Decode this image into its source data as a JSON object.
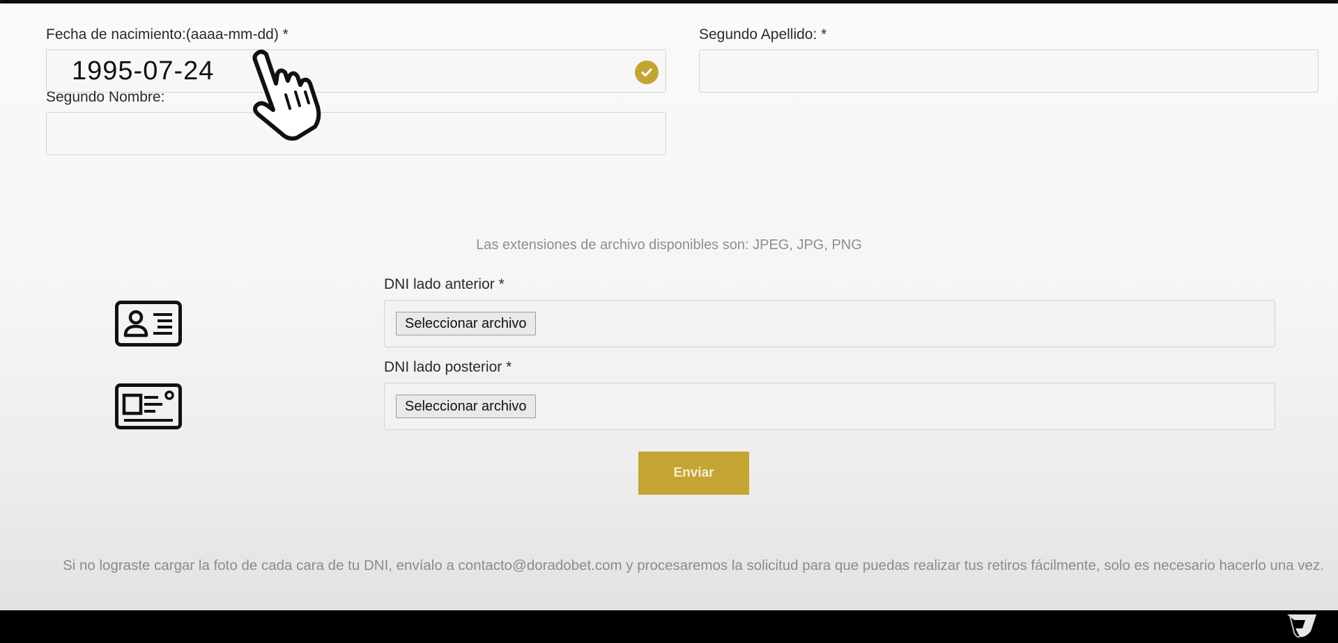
{
  "form": {
    "birthdate_label": "Fecha de nacimiento:(aaaa-mm-dd) *",
    "birthdate_value": "1995-07-24",
    "second_surname_label": "Segundo Apellido: *",
    "second_surname_value": "",
    "second_name_label": "Segundo Nombre:",
    "second_name_value": ""
  },
  "upload": {
    "extensions_note": "Las extensiones de archivo disponibles son: JPEG, JPG, PNG",
    "front_label": "DNI lado anterior *",
    "front_button": "Seleccionar archivo",
    "back_label": "DNI lado posterior *",
    "back_button": "Seleccionar archivo"
  },
  "submit_label": "Enviar",
  "footer_note": "Si no lograste cargar la foto de cada cara de tu DNI, envíalo a contacto@doradobet.com y procesaremos la solicitud para que puedas realizar tus retiros fácilmente, solo es necesario hacerlo una vez.",
  "icons": {
    "valid": "check-circle-icon",
    "id_front": "id-card-front-icon",
    "id_back": "id-card-back-icon",
    "cursor": "hand-pointer-icon",
    "logo": "brand-logo-icon"
  },
  "colors": {
    "accent": "#c4a533",
    "background": "#f6f6f6",
    "muted_text": "#8b8b8b"
  }
}
